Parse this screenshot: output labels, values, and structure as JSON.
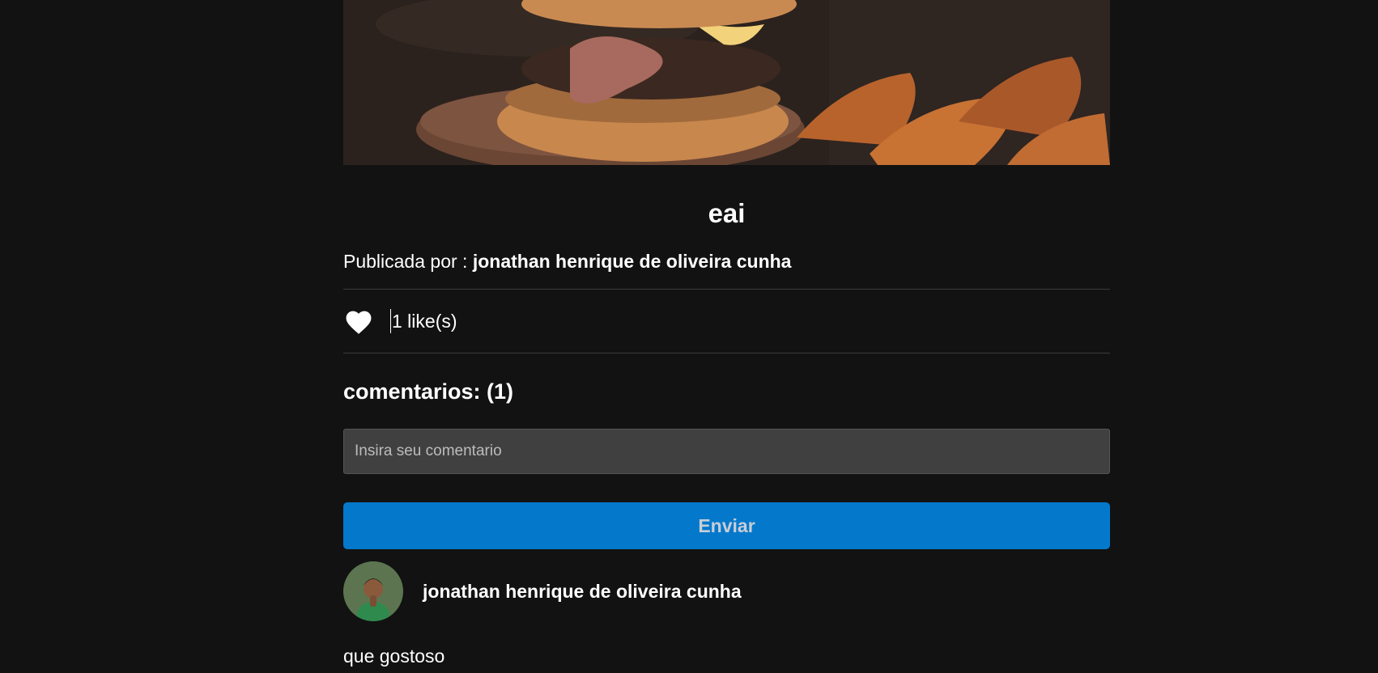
{
  "post": {
    "image_alt": "burger and potato wedges photo",
    "title": "eai",
    "published_by_label": "Publicada por :",
    "author": "jonathan henrique de oliveira cunha",
    "likes_text": "1 like(s)",
    "heart_icon": "heart-icon"
  },
  "comments": {
    "title": "comentarios: (1)",
    "input_placeholder": "Insira seu comentario",
    "send_label": "Enviar",
    "items": [
      {
        "author": "jonathan henrique de oliveira cunha",
        "text": "que gostoso",
        "avatar_icon": "user-avatar"
      }
    ]
  },
  "colors": {
    "background": "#121212",
    "text": "#ffffff",
    "input_bg": "#404040",
    "button_bg": "#0479cc",
    "divider": "#3b3b3b"
  }
}
